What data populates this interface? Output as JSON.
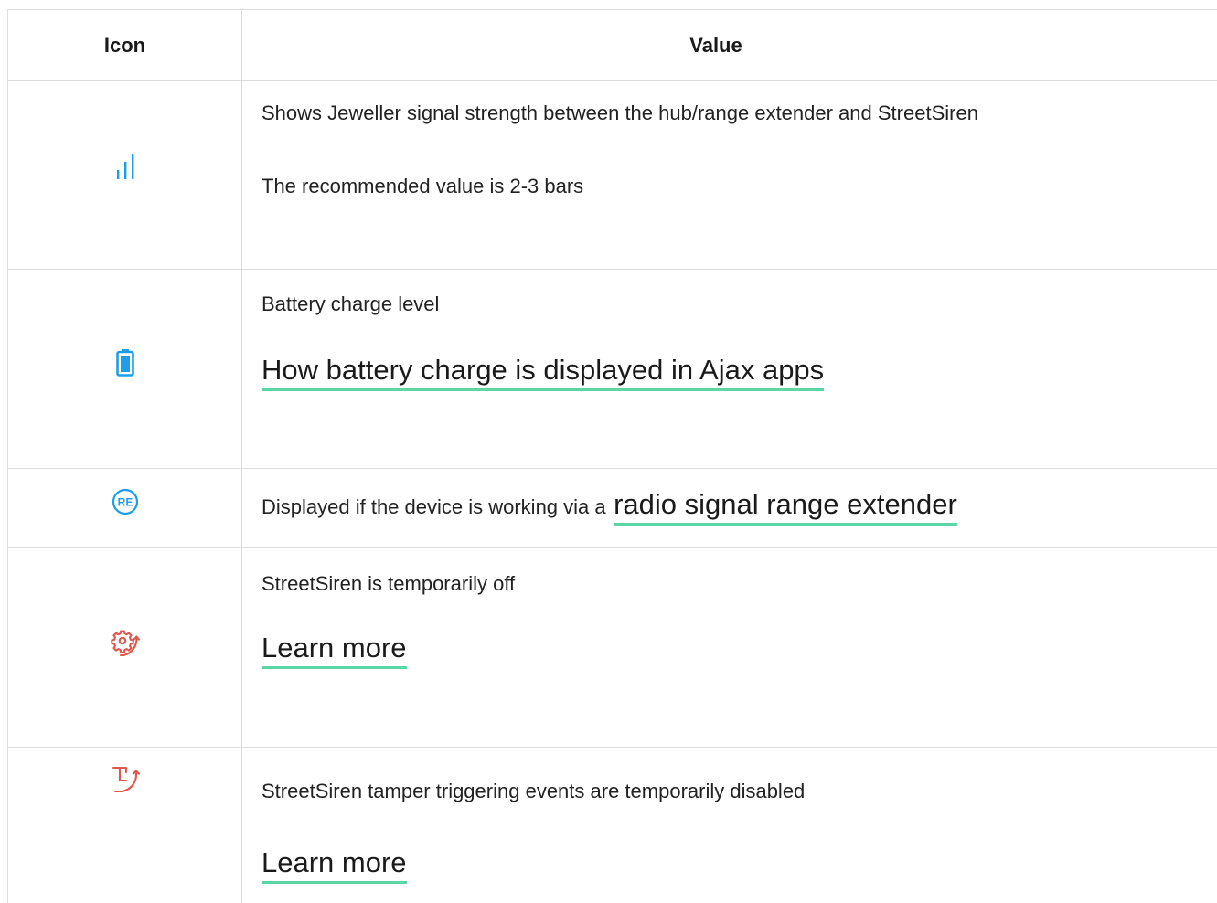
{
  "table": {
    "headers": {
      "icon": "Icon",
      "value": "Value"
    },
    "rows": [
      {
        "icon": "signal-strength-icon",
        "lines": [
          "Shows Jeweller signal strength between the hub/range extender and StreetSiren",
          "The recommended value is 2-3 bars"
        ]
      },
      {
        "icon": "battery-icon",
        "text": "Battery charge level",
        "link": "How battery charge is displayed in Ajax apps"
      },
      {
        "icon": "range-extender-icon",
        "icon_text": "RE",
        "text": "Displayed if the device is working via a",
        "link": "radio signal range extender"
      },
      {
        "icon": "temporarily-off-gear-icon",
        "text": "StreetSiren is temporarily off",
        "link": "Learn more"
      },
      {
        "icon": "tamper-disabled-icon",
        "text": "StreetSiren tamper triggering events are temporarily disabled",
        "link": "Learn more"
      }
    ]
  },
  "colors": {
    "icon_blue": "#1f9ee8",
    "icon_red": "#e2574c",
    "link_underline": "#5cd6a6",
    "border": "#dcdcdc"
  }
}
